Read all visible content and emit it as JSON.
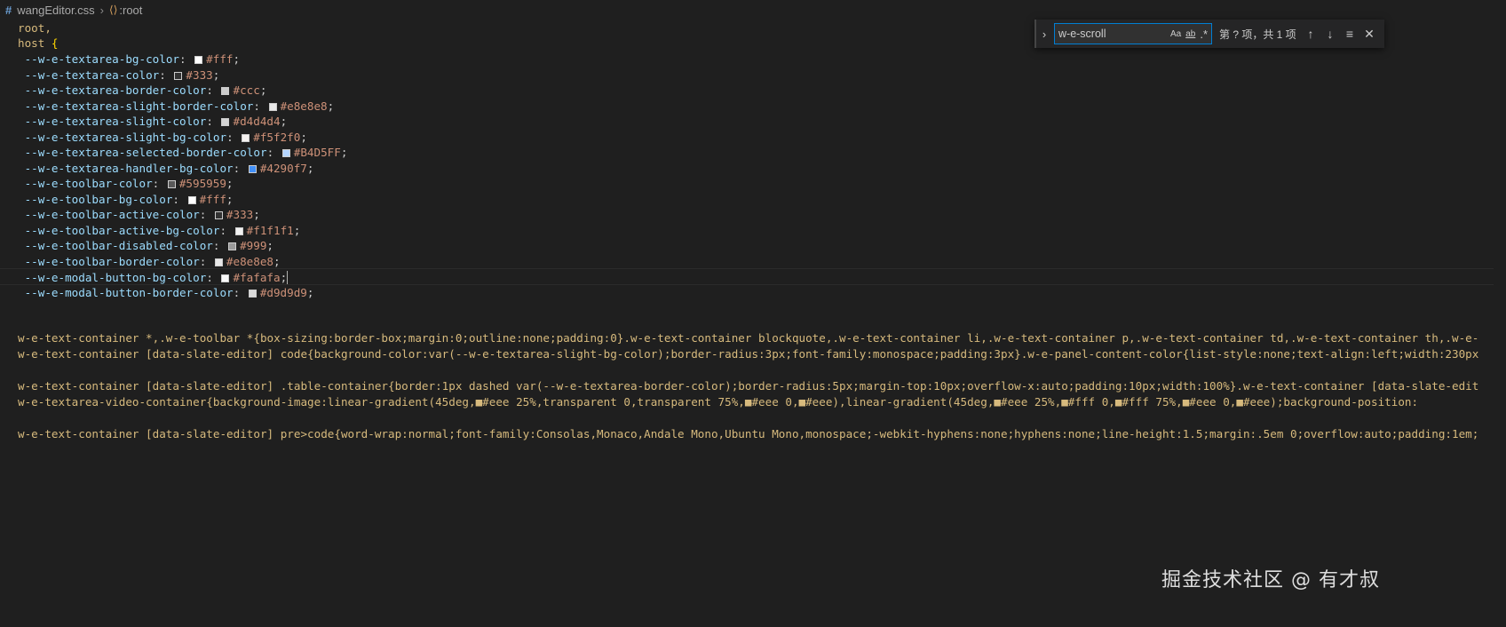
{
  "breadcrumb": {
    "file_icon": "css-hash-icon",
    "file": "wangEditor.css",
    "symbol_icon": "selector-symbol-icon",
    "symbol": ":root"
  },
  "find_widget": {
    "query": "w-e-scroll",
    "match_case": "Aa",
    "whole_word": "ab",
    "regex": ".*",
    "result": "第 ? 项，共 1 项"
  },
  "code": {
    "selector_line1": "root,",
    "selector_line2": "host ",
    "open_brace": "{",
    "variables": [
      {
        "name": "--w-e-textarea-bg-color",
        "value": "#fff",
        "swatch": "#ffffff"
      },
      {
        "name": "--w-e-textarea-color",
        "value": "#333",
        "swatch": "#333333"
      },
      {
        "name": "--w-e-textarea-border-color",
        "value": "#ccc",
        "swatch": "#cccccc"
      },
      {
        "name": "--w-e-textarea-slight-border-color",
        "value": "#e8e8e8",
        "swatch": "#e8e8e8"
      },
      {
        "name": "--w-e-textarea-slight-color",
        "value": "#d4d4d4",
        "swatch": "#d4d4d4"
      },
      {
        "name": "--w-e-textarea-slight-bg-color",
        "value": "#f5f2f0",
        "swatch": "#f5f2f0"
      },
      {
        "name": "--w-e-textarea-selected-border-color",
        "value": "#B4D5FF",
        "swatch": "#B4D5FF"
      },
      {
        "name": "--w-e-textarea-handler-bg-color",
        "value": "#4290f7",
        "swatch": "#4290f7"
      },
      {
        "name": "--w-e-toolbar-color",
        "value": "#595959",
        "swatch": "#595959"
      },
      {
        "name": "--w-e-toolbar-bg-color",
        "value": "#fff",
        "swatch": "#ffffff"
      },
      {
        "name": "--w-e-toolbar-active-color",
        "value": "#333",
        "swatch": "#333333"
      },
      {
        "name": "--w-e-toolbar-active-bg-color",
        "value": "#f1f1f1",
        "swatch": "#f1f1f1"
      },
      {
        "name": "--w-e-toolbar-disabled-color",
        "value": "#999",
        "swatch": "#999999"
      },
      {
        "name": "--w-e-toolbar-border-color",
        "value": "#e8e8e8",
        "swatch": "#e8e8e8"
      },
      {
        "name": "--w-e-modal-button-bg-color",
        "value": "#fafafa",
        "swatch": "#fafafa"
      },
      {
        "name": "--w-e-modal-button-border-color",
        "value": "#d9d9d9",
        "swatch": "#d9d9d9"
      }
    ],
    "long_lines": [
      "w-e-text-container *,.w-e-toolbar *{box-sizing:border-box;margin:0;outline:none;padding:0}.w-e-text-container blockquote,.w-e-text-container li,.w-e-text-container p,.w-e-text-container td,.w-e-text-container th,.w-e-",
      "w-e-text-container [data-slate-editor] code{background-color:var(--w-e-textarea-slight-bg-color);border-radius:3px;font-family:monospace;padding:3px}.w-e-panel-content-color{list-style:none;text-align:left;width:230px",
      "",
      "w-e-text-container [data-slate-editor] .table-container{border:1px dashed var(--w-e-textarea-border-color);border-radius:5px;margin-top:10px;overflow-x:auto;padding:10px;width:100%}.w-e-text-container [data-slate-edit",
      "w-e-textarea-video-container{background-image:linear-gradient(45deg,■#eee 25%,transparent 0,transparent 75%,■#eee 0,■#eee),linear-gradient(45deg,■#eee 25%,■#fff 0,■#fff 75%,■#eee 0,■#eee);background-position:",
      "",
      "w-e-text-container [data-slate-editor] pre>code{word-wrap:normal;font-family:Consolas,Monaco,Andale Mono,Ubuntu Mono,monospace;-webkit-hyphens:none;hyphens:none;line-height:1.5;margin:.5em 0;overflow:auto;padding:1em;"
    ]
  },
  "watermark": "掘金技术社区 @ 有才叔"
}
